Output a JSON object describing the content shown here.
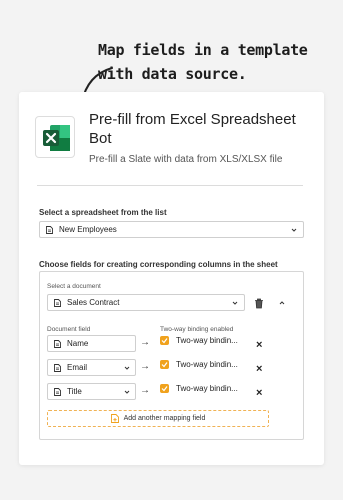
{
  "annotation": {
    "text": "Map fields in a template with data source."
  },
  "header": {
    "logo_icon": "excel-logo-icon",
    "title": "Pre-fill from Excel Spreadsheet Bot",
    "subtitle": "Pre-fill a Slate with data from XLS/XLSX file"
  },
  "spreadsheet": {
    "label": "Select a spreadsheet from the list",
    "value": "New Employees"
  },
  "fields_section": {
    "label": "Choose fields for creating corresponding columns in the sheet",
    "document_label": "Select a document",
    "document_value": "Sales Contract",
    "column_document_field": "Document field",
    "column_binding": "Two-way binding enabled",
    "rows": [
      {
        "field": "Name",
        "binding": "Two-way bindin..."
      },
      {
        "field": "Email",
        "binding": "Two-way bindin..."
      },
      {
        "field": "Title",
        "binding": "Two-way bindin..."
      }
    ],
    "add_label": "Add another mapping field"
  },
  "colors": {
    "accent": "#f0a21d",
    "excel_green": "#1d7044"
  }
}
